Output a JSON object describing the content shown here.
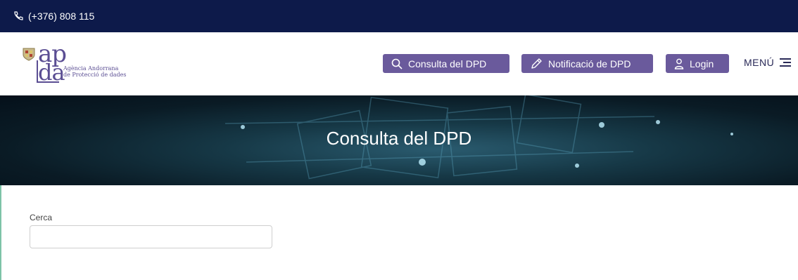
{
  "topbar": {
    "phone": "(+376) 808 115"
  },
  "logo": {
    "ap": "ap",
    "da": "da",
    "line1": "Agència Andorrana",
    "line2": "de Protecció de dades"
  },
  "nav": {
    "consulta_label": "Consulta del DPD",
    "notificacio_label": "Notificació de DPD",
    "login_label": "Login",
    "menu_label": "MENÚ"
  },
  "hero": {
    "title": "Consulta del DPD"
  },
  "search": {
    "label": "Cerca",
    "value": "",
    "placeholder": ""
  },
  "colors": {
    "topbar": "#0d1a4a",
    "button": "#6a5a9c",
    "logo": "#5b4e93"
  },
  "icons": [
    "phone-icon",
    "search-icon",
    "pencil-icon",
    "user-icon",
    "hamburger-icon"
  ]
}
